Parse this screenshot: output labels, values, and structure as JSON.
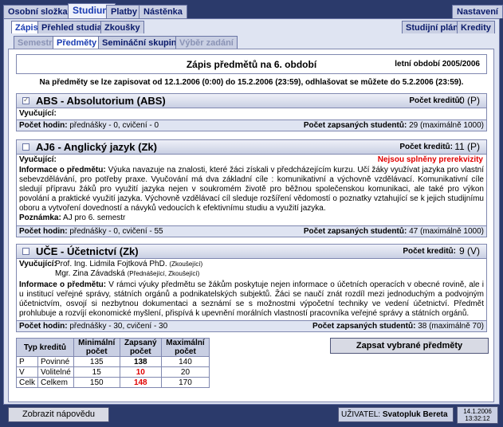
{
  "main_tabs": [
    "Osobní složka",
    "Studium",
    "Platby",
    "Nástěnka"
  ],
  "settings_tab": "Nastavení",
  "sub_tabs": [
    "Zápis",
    "Přehled studia",
    "Zkoušky"
  ],
  "right_tabs": [
    "Studijní plán",
    "Kredity"
  ],
  "inner_tabs": [
    "Semestr",
    "Předměty",
    "Semináční skupiny",
    "Výběr zadání"
  ],
  "header": {
    "title": "Zápis předmětů na 6. období",
    "period": "letní období 2005/2006",
    "note": "Na předměty se lze zapisovat od 12.1.2006 (0:00) do 15.2.2006 (23:59), odhlašovat se můžete do 5.2.2006 (23:59)."
  },
  "subjects": [
    {
      "title": "ABS - Absolutorium (ABS)",
      "credits_label": "Počet kreditů:",
      "credits": "0 (P)",
      "teachers_label": "Vyučující:",
      "hours_label": "Počet hodin:",
      "hours": "přednášky - 0, cvičení - 0",
      "students_label": "Počet zapsaných studentů:",
      "students": "29 (maximálně 1000)"
    },
    {
      "title": "AJ6 - Anglický jazyk (Zk)",
      "credits_label": "Počet kreditů:",
      "credits": "11 (P)",
      "teachers_label": "Vyučující:",
      "warning": "Nejsou splněny prerekvizity",
      "info_label": "Informace o předmětu:",
      "info": "Výuka navazuje na znalosti, které žáci získali v předcházejícím kurzu. Učí žáky využívat jazyka pro vlastní sebevzdělávání, pro potřeby praxe. Vyučování má dva základní cíle : komunikativní a výchovně vzdělávací. Komunikativní cíle sledují přípravu žáků pro využití jazyka nejen v soukromém životě pro běžnou společenskou komunikaci, ale také pro výkon povolání a praktické využití jazyka. Výchovně vzdělávací cíl sleduje rozšíření vědomostí o poznatky vztahující se k jejich studijnímu oboru a vytvoření dovedností a návyků vedoucích k efektivnímu studiu a využití jazyka.",
      "remark_label": "Poznámka:",
      "remark": "AJ pro 6. semestr",
      "hours_label": "Počet hodin:",
      "hours": "přednášky - 0, cvičení - 55",
      "students_label": "Počet zapsaných studentů:",
      "students": "47 (maximálně 1000)"
    },
    {
      "title": "UČE - Účetnictví (Zk)",
      "credits_label": "Počet kreditů:",
      "credits": "9 (V)",
      "teachers_label": "Vyučující:",
      "teacher1": "Prof. Ing. Lidmila Fojtková PhD.",
      "teacher1_role": "(Zkoušející)",
      "teacher2": "Mgr. Zina Závadská",
      "teacher2_role": "(Přednášející, Zkoušející)",
      "info_label": "Informace o předmětu:",
      "info": "V rámci výuky předmětu se žákům poskytuje nejen informace o účetních operacích v obecné rovině, ale i u institucí veřejné správy, státních orgánů a podnikatelských subjektů. Žáci se naučí znát rozdíl mezi jednoduchým a podvojným účetnictvím, osvojí si nezbytnou dokumentaci a seznámí se s možnostmi výpočetní techniky ve vedení účetnictví. Předmět prohlubuje a rozvíjí ekonomické myšlení, přispívá k upevnění morálních vlastností pracovníka veřejné správy a státních orgánů.",
      "hours_label": "Počet hodin:",
      "hours": "přednášky - 30, cvičení - 30",
      "students_label": "Počet zapsaných studentů:",
      "students": "38 (maximálně 70)"
    }
  ],
  "summary": {
    "headers": [
      "Typ kreditů",
      "Minimální počet",
      "Zapsaný počet",
      "Maximální počet"
    ],
    "rows": [
      [
        "P",
        "Povinné",
        "135",
        "138",
        "140"
      ],
      [
        "V",
        "Volitelné",
        "15",
        "10",
        "20"
      ],
      [
        "Celk",
        "Celkem",
        "150",
        "148",
        "170"
      ]
    ]
  },
  "submit_button": "Zapsat vybrané předměty",
  "help_button": "Zobrazit nápovědu",
  "user_label": "UŽIVATEL:",
  "user_name": "Svatopluk Bereta",
  "date": "14.1.2006",
  "time": "13:32:12",
  "colors": {
    "accent": "#1b3db3",
    "warning": "#e00000",
    "background": "#2b3a6b"
  }
}
